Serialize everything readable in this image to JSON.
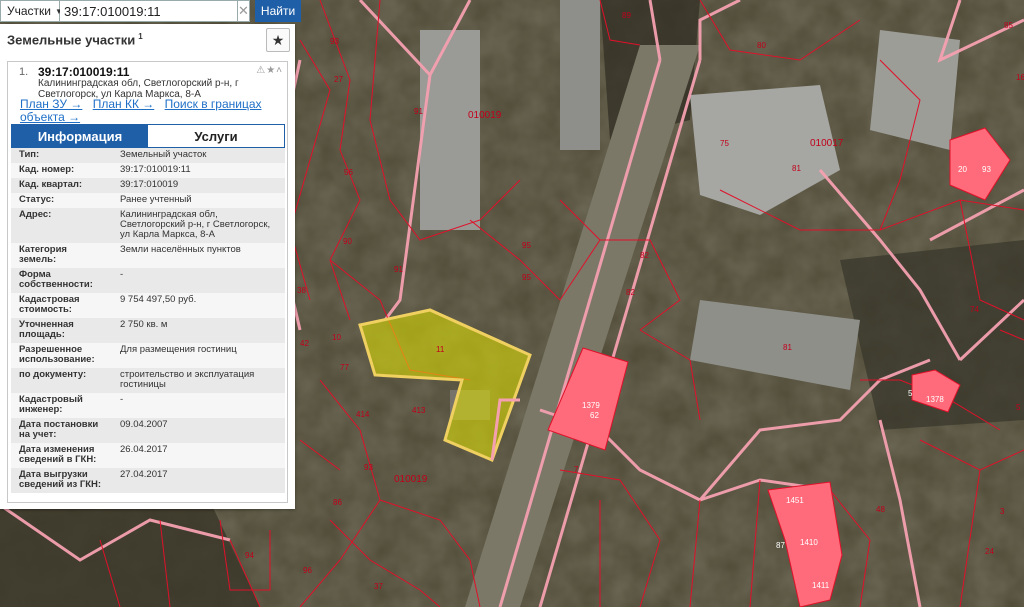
{
  "search": {
    "type_label": "Участки",
    "query": "39:17:010019:11",
    "clear_icon": "close-icon",
    "button_label": "Найти"
  },
  "panel": {
    "title": "Земельные участки",
    "title_sup": "1",
    "star_icon": "star-icon"
  },
  "result": {
    "number": "1.",
    "cadastral_number": "39:17:010019:11",
    "address": "Калининградская обл, Светлогорский р-н, г Светлогорск, ул Карла Маркса, 8-А",
    "links": [
      "План ЗУ →",
      "План КК →",
      "Поиск в границах объекта →"
    ]
  },
  "tabs": [
    "Информация",
    "Услуги"
  ],
  "info_rows": [
    {
      "key": "Тип:",
      "value": "Земельный участок"
    },
    {
      "key": "Кад. номер:",
      "value": "39:17:010019:11",
      "link": true
    },
    {
      "key": "Кад. квартал:",
      "value": "39:17:010019",
      "link": true
    },
    {
      "key": "Статус:",
      "value": "Ранее учтенный"
    },
    {
      "key": "Адрес:",
      "value": "Калининградская обл, Светлогорский р-н, г Светлогорск, ул Карла Маркса, 8-А"
    },
    {
      "key": "Категория земель:",
      "value": "Земли населённых пунктов"
    },
    {
      "key": "Форма собственности:",
      "value": "-"
    },
    {
      "key": "Кадастровая стоимость:",
      "value": "9 754 497,50 руб."
    },
    {
      "key": "Уточненная площадь:",
      "value": "2 750 кв. м"
    },
    {
      "key": "Разрешенное использование:",
      "value": "Для размещения гостиниц"
    },
    {
      "key": "по документу:",
      "value": "строительство и эксплуатация гостиницы"
    },
    {
      "key": "Кадастровый инженер:",
      "value": "-"
    },
    {
      "key": "Дата постановки на учет:",
      "value": "09.04.2007"
    },
    {
      "key": "Дата изменения сведений в ГКН:",
      "value": "26.04.2017"
    },
    {
      "key": "Дата выгрузки сведений из ГКН:",
      "value": "27.04.2017"
    }
  ],
  "map": {
    "quarter_labels": [
      "010019",
      "010017",
      "010019"
    ],
    "parcel_labels": [
      "89",
      "80",
      "91",
      "93",
      "56",
      "90",
      "91",
      "95",
      "95",
      "82",
      "82",
      "75",
      "81",
      "81",
      "74",
      "20",
      "93",
      "10",
      "414",
      "413",
      "11",
      "77",
      "5",
      "1378",
      "1379",
      "62",
      "7",
      "1451",
      "1410",
      "1411",
      "87",
      "48",
      "24",
      "3",
      "37",
      "94",
      "96",
      "86",
      "93",
      "27",
      "38",
      "85",
      "16",
      "5",
      "42"
    ],
    "colors": {
      "parcel_line": "#e0102a",
      "quarter_line": "#f5a0b0",
      "selected_fill": "#e6e600",
      "building_fill": "#ff6b7a"
    }
  }
}
